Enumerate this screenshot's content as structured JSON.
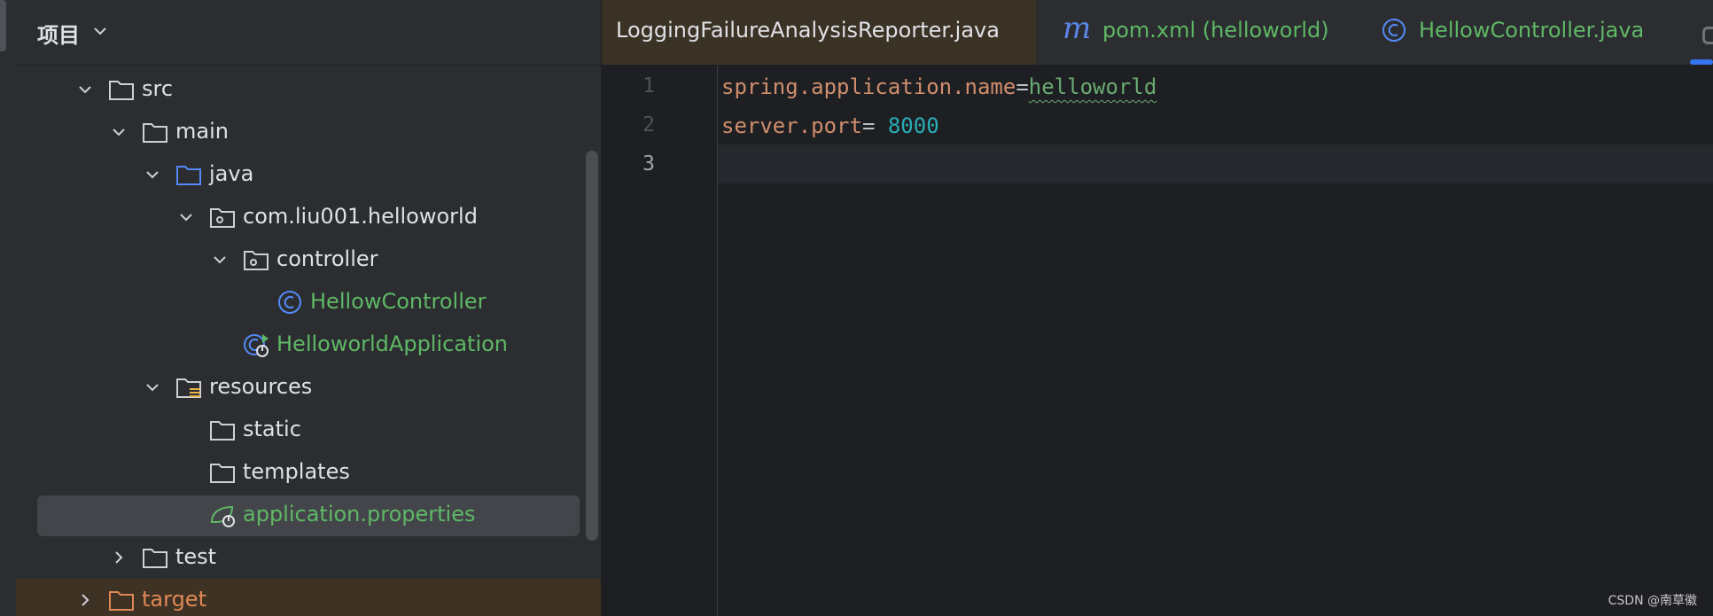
{
  "project_panel": {
    "title": "项目",
    "tree": [
      {
        "label": "src",
        "icon": "folder-icon"
      },
      {
        "label": "main",
        "icon": "folder-icon"
      },
      {
        "label": "java",
        "icon": "source-folder-icon"
      },
      {
        "label": "com.liu001.helloworld",
        "icon": "package-icon"
      },
      {
        "label": "controller",
        "icon": "package-icon"
      },
      {
        "label": "HellowController",
        "icon": "class-icon"
      },
      {
        "label": "HelloworldApplication",
        "icon": "spring-boot-app-icon"
      },
      {
        "label": "resources",
        "icon": "resources-folder-icon"
      },
      {
        "label": "static",
        "icon": "folder-icon"
      },
      {
        "label": "templates",
        "icon": "folder-icon"
      },
      {
        "label": "application.properties",
        "icon": "spring-properties-icon"
      },
      {
        "label": "test",
        "icon": "folder-icon"
      },
      {
        "label": "target",
        "icon": "excluded-folder-icon"
      }
    ]
  },
  "editor": {
    "tabs": [
      {
        "label": "LoggingFailureAnalysisReporter.java"
      },
      {
        "label": "pom.xml (helloworld)",
        "icon_text": "m"
      },
      {
        "label": "HellowController.java"
      }
    ],
    "line_numbers": [
      "1",
      "2",
      "3"
    ],
    "lines": [
      {
        "key": "spring.application.name",
        "sep": "=",
        "value": "helloworld"
      },
      {
        "key": "server.port",
        "sep": "= ",
        "value": "8000"
      }
    ]
  },
  "watermark": "CSDN @南草徽",
  "colors": {
    "accent": "#3574f0",
    "green_text": "#5fb865",
    "orange_text": "#e08855",
    "key": "#cf8e6d",
    "number": "#2aacb8"
  }
}
